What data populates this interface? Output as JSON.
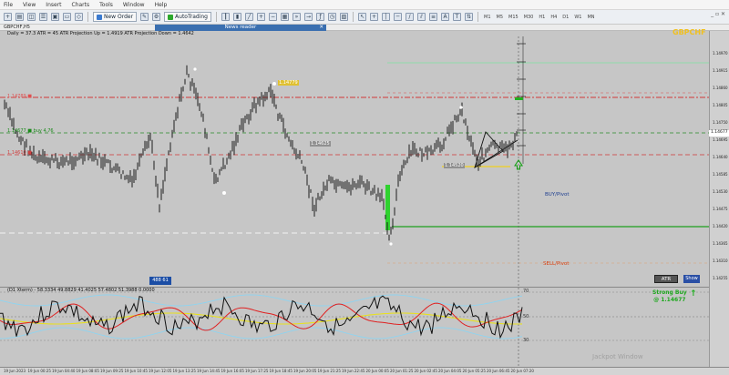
{
  "menu": [
    "File",
    "View",
    "Insert",
    "Charts",
    "Tools",
    "Window",
    "Help"
  ],
  "toolbar": {
    "new_order": "New Order",
    "autotrading": "AutoTrading",
    "timeframes": [
      "M1",
      "M5",
      "M15",
      "M30",
      "H1",
      "H4",
      "D1",
      "W1",
      "MN"
    ]
  },
  "chart": {
    "title": "GBPCHF,H5",
    "news_reader": "News reader",
    "info_line": "Daily = 37.3    ATR = 45    ATR Projection Up = 1.4919    ATR Projection Down = 1.4642",
    "symbol": "GBPCHF",
    "buy_pivot": "BUY/Pivot",
    "sell_pivot": "SELL/Pivot",
    "blue_box": "488 61",
    "atr_btn": "ATR",
    "show_btn": "Show",
    "strong_buy": "Strong Buy",
    "strong_buy_price": "@ 1.14677",
    "watermark": "Jackpot Window",
    "levels": [
      {
        "text": "1.14789 ■",
        "color": "#e05050"
      },
      {
        "text": "1.14677 ■ buy 4.76",
        "color": "#1a8a1a"
      },
      {
        "text": "1.14610 ■",
        "color": "#d04040"
      },
      {
        "text": "1.14779",
        "color": "#ffffff"
      },
      {
        "text": "1.14625",
        "color": "#ffffff"
      },
      {
        "text": "1.14520",
        "color": "#ffffff"
      }
    ]
  },
  "price_axis": [
    "1.14970",
    "1.14915",
    "1.14860",
    "1.14805",
    "1.14750",
    "1.14695",
    "1.14640",
    "1.14585",
    "1.14530",
    "1.14475",
    "1.14420",
    "1.14365",
    "1.14310",
    "1.14255"
  ],
  "price_current": "1.14677",
  "osc": {
    "title": "(D1 Xterm) - 58.3334 49.8829 41.4025 57.4802 51.3988 0.0000",
    "levels": [
      "70",
      "50",
      "30"
    ]
  },
  "time_axis": [
    "19 Jun 2023",
    "19 Jun 00:25",
    "19 Jun 04:40",
    "19 Jun 08:05",
    "19 Jun 09:25",
    "19 Jun 10:45",
    "19 Jun 12:05",
    "19 Jun 13:25",
    "19 Jun 14:45",
    "19 Jun 16:05",
    "19 Jun 17:25",
    "19 Jun 18:45",
    "19 Jun 20:05",
    "19 Jun 21:25",
    "19 Jun 22:45",
    "20 Jun 00:05",
    "20 Jun 01:25",
    "20 Jun 02:45",
    "20 Jun 04:05",
    "20 Jun 05:25",
    "20 Jun 06:45",
    "20 Jun 07:20"
  ],
  "colors": {
    "chart_bg": "#c6c6c6",
    "bull": "#1f1f1f",
    "green": "#2fd22f",
    "red_line": "#e03030"
  }
}
